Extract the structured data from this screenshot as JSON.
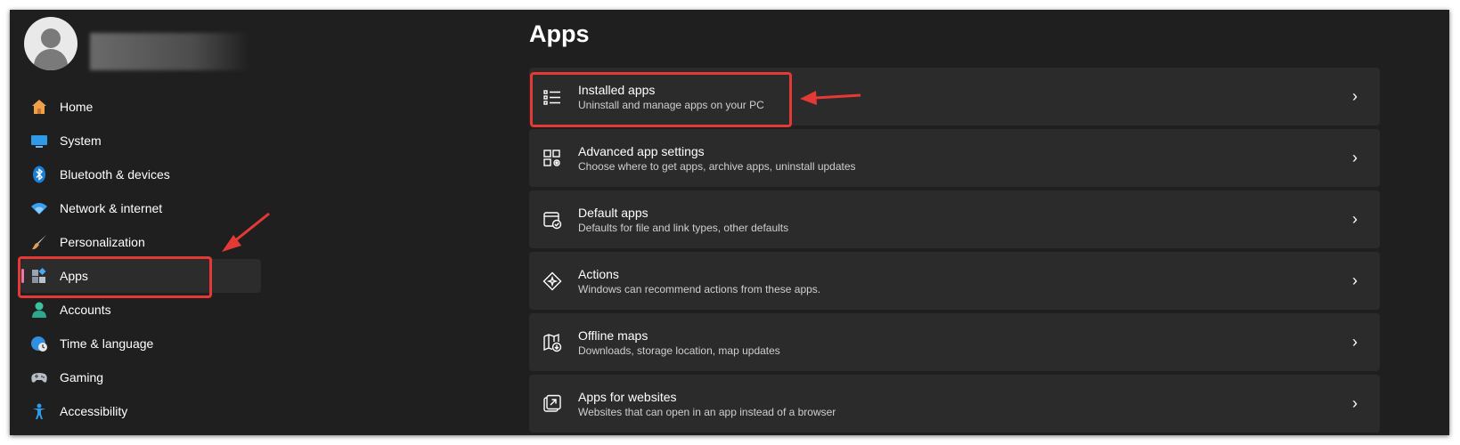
{
  "profile": {
    "avatar_icon": "person-icon"
  },
  "nav": {
    "items": [
      {
        "label": "Home",
        "icon": "home-icon"
      },
      {
        "label": "System",
        "icon": "display-icon"
      },
      {
        "label": "Bluetooth & devices",
        "icon": "bluetooth-icon"
      },
      {
        "label": "Network & internet",
        "icon": "wifi-icon"
      },
      {
        "label": "Personalization",
        "icon": "brush-icon"
      },
      {
        "label": "Apps",
        "icon": "apps-icon",
        "selected": true
      },
      {
        "label": "Accounts",
        "icon": "account-icon"
      },
      {
        "label": "Time & language",
        "icon": "globe-clock-icon"
      },
      {
        "label": "Gaming",
        "icon": "gamepad-icon"
      },
      {
        "label": "Accessibility",
        "icon": "accessibility-icon"
      }
    ]
  },
  "main": {
    "title": "Apps",
    "cards": [
      {
        "title": "Installed apps",
        "desc": "Uninstall and manage apps on your PC",
        "icon": "list-icon"
      },
      {
        "title": "Advanced app settings",
        "desc": "Choose where to get apps, archive apps, uninstall updates",
        "icon": "app-settings-icon"
      },
      {
        "title": "Default apps",
        "desc": "Defaults for file and link types, other defaults",
        "icon": "default-apps-icon"
      },
      {
        "title": "Actions",
        "desc": "Windows can recommend actions from these apps.",
        "icon": "sparkle-icon"
      },
      {
        "title": "Offline maps",
        "desc": "Downloads, storage location, map updates",
        "icon": "map-download-icon"
      },
      {
        "title": "Apps for websites",
        "desc": "Websites that can open in an app instead of a browser",
        "icon": "open-external-icon"
      }
    ],
    "chevron": "›"
  },
  "colors": {
    "window_bg": "#1f1f1f",
    "card_bg": "#2b2b2b",
    "selected_bg": "#2c2c2c",
    "selection_indicator": "#e57ba6",
    "annotation_red": "#e53935"
  }
}
